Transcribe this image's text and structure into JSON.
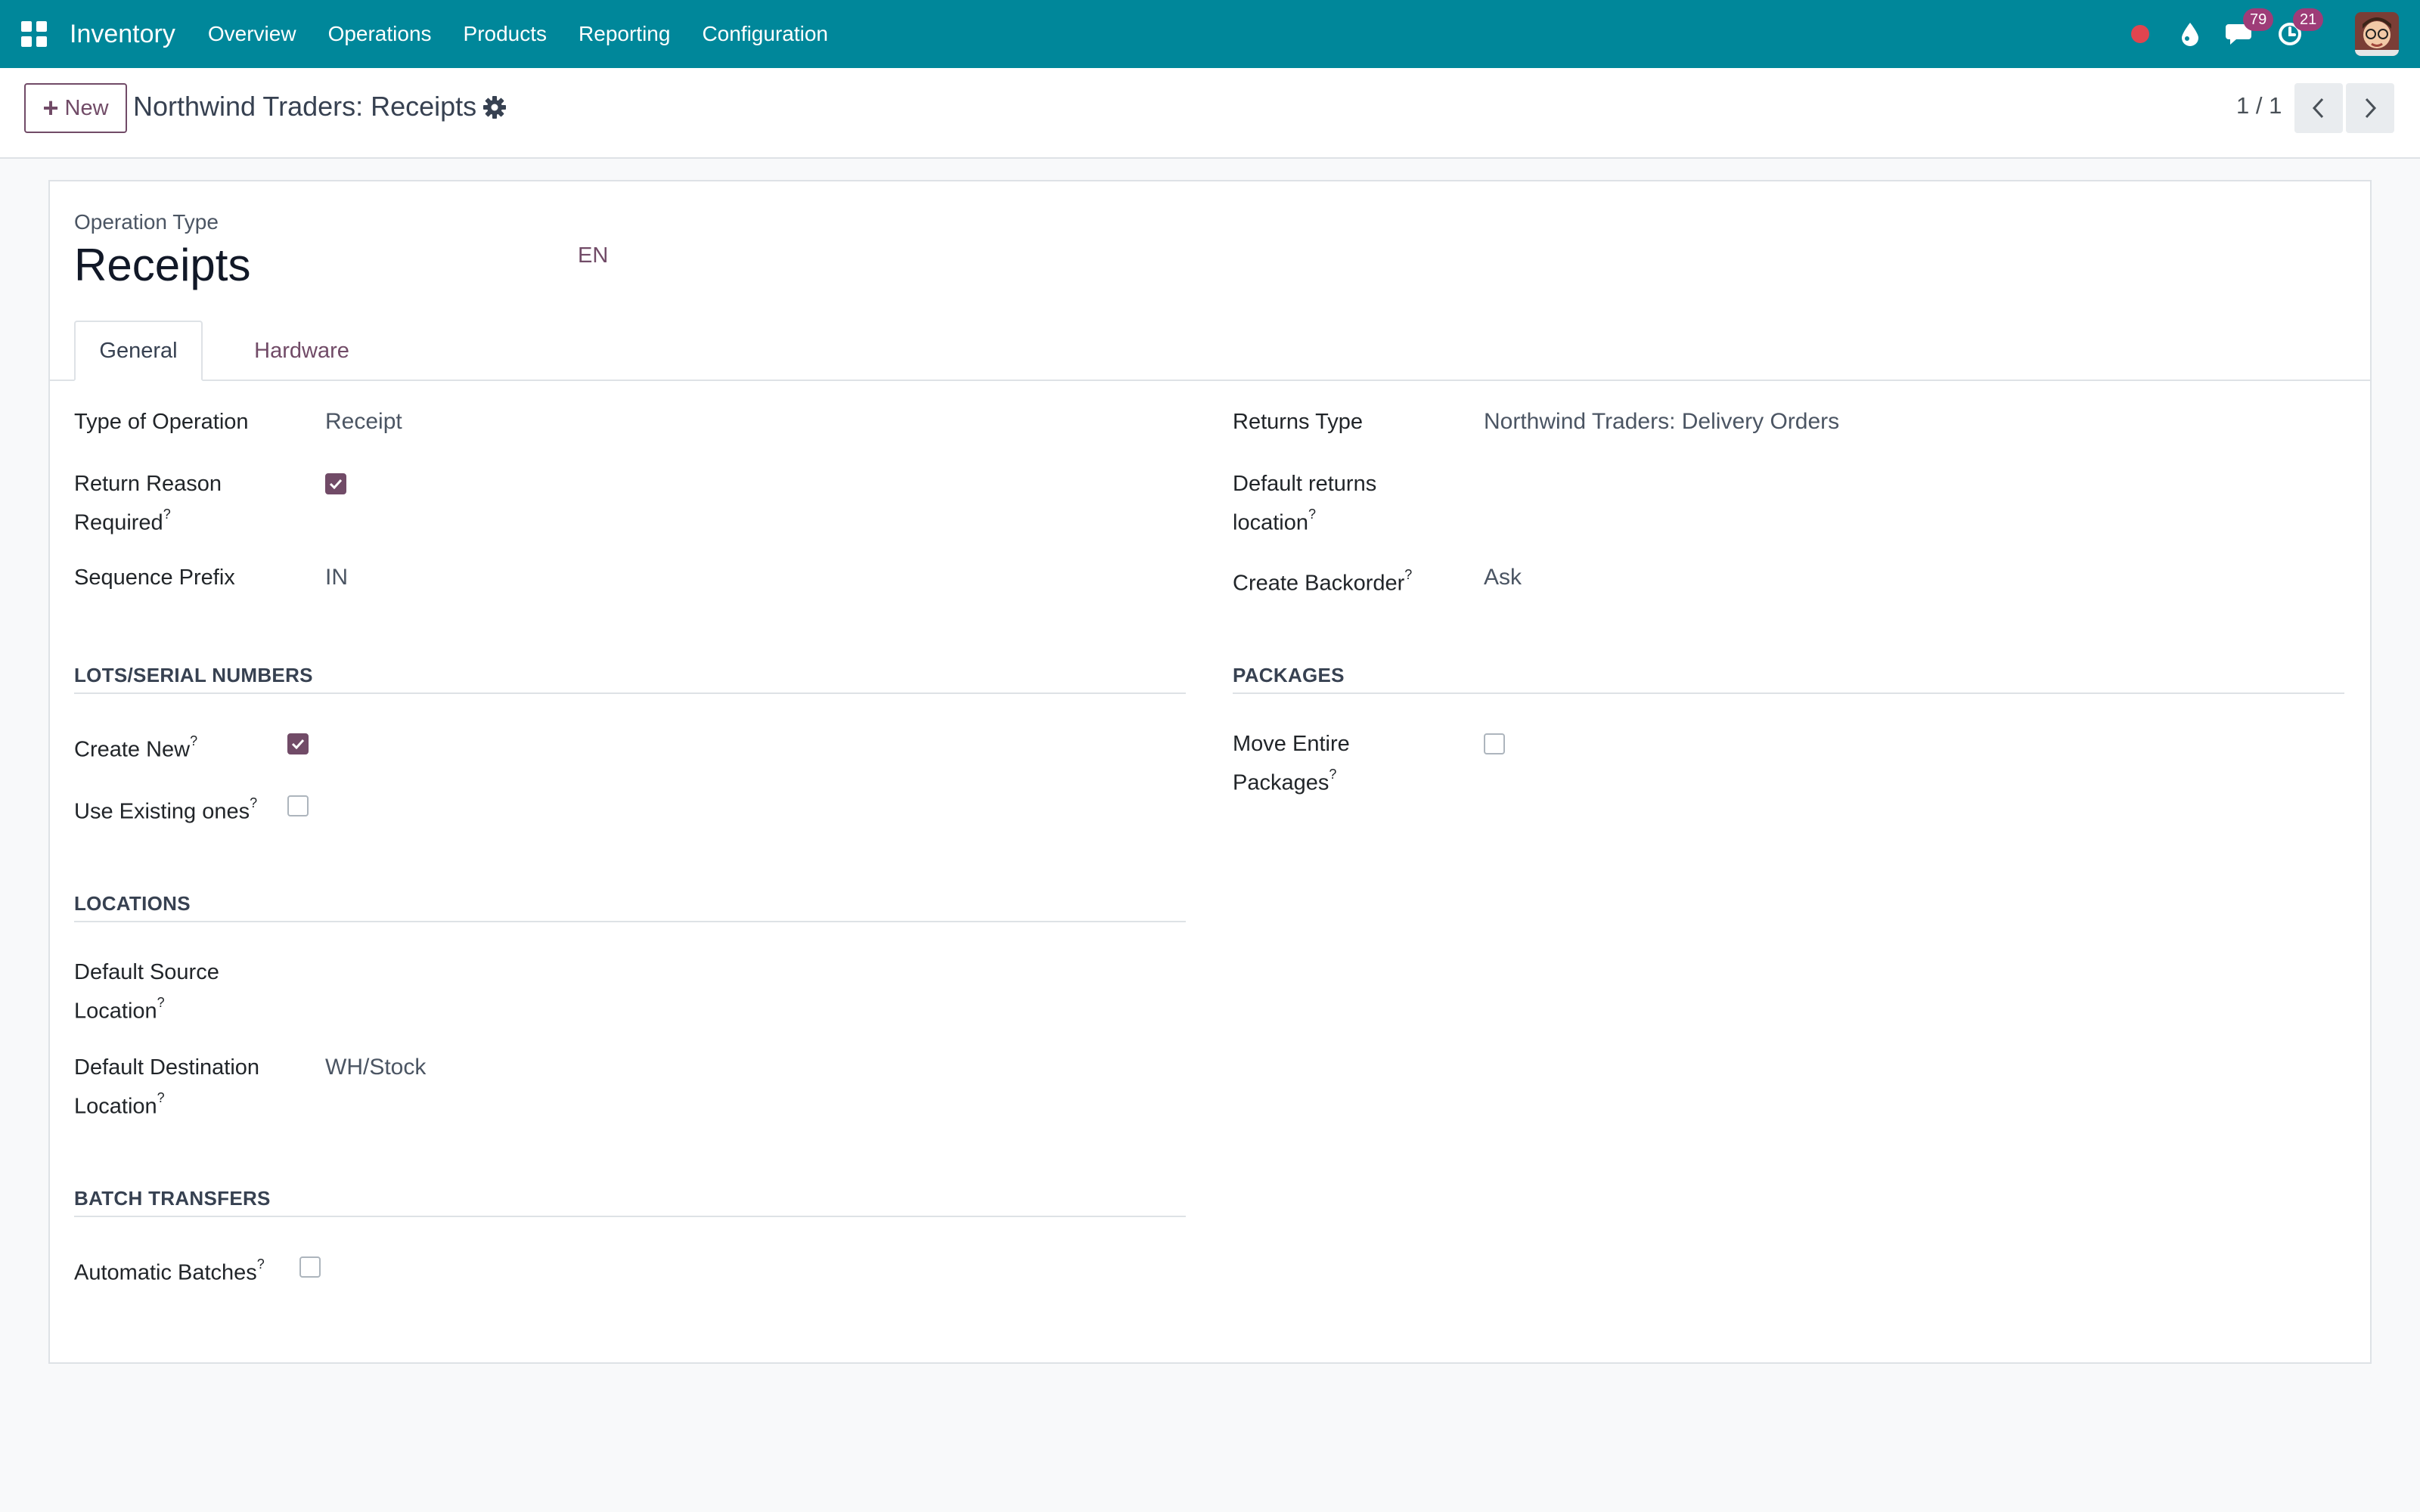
{
  "navbar": {
    "app_name": "Inventory",
    "menu": [
      "Overview",
      "Operations",
      "Products",
      "Reporting",
      "Configuration"
    ],
    "messages_count": "79",
    "activities_count": "21",
    "accent_color": "#00879a"
  },
  "control": {
    "new_label": "New",
    "breadcrumb": "Northwind Traders: Receipts",
    "pager": "1 / 1"
  },
  "form": {
    "record_label": "Operation Type",
    "record_name": "Receipts",
    "lang": "EN",
    "tabs": [
      "General",
      "Hardware"
    ],
    "left": {
      "type_of_operation": {
        "label": "Type of Operation",
        "value": "Receipt"
      },
      "return_reason": {
        "label_line1": "Return Reason",
        "label_line2": "Required",
        "checked": true
      },
      "sequence_prefix": {
        "label": "Sequence Prefix",
        "value": "IN"
      }
    },
    "right": {
      "returns_type": {
        "label": "Returns Type",
        "value": "Northwind Traders: Delivery Orders"
      },
      "default_returns_location": {
        "label_line1": "Default returns",
        "label_line2": "location",
        "value": ""
      },
      "create_backorder": {
        "label": "Create Backorder",
        "value": "Ask"
      }
    },
    "lots": {
      "title": "LOTS/SERIAL NUMBERS",
      "create_new": {
        "label": "Create New",
        "checked": true
      },
      "use_existing": {
        "label": "Use Existing ones",
        "checked": false
      }
    },
    "packages": {
      "title": "PACKAGES",
      "move_entire": {
        "label_line1": "Move Entire",
        "label_line2": "Packages",
        "checked": false
      }
    },
    "locations": {
      "title": "LOCATIONS",
      "default_source": {
        "label_line1": "Default Source",
        "label_line2": "Location",
        "value": ""
      },
      "default_destination": {
        "label_line1": "Default Destination",
        "label_line2": "Location",
        "value": "WH/Stock"
      }
    },
    "batch": {
      "title": "BATCH TRANSFERS",
      "automatic": {
        "label": "Automatic Batches",
        "checked": false
      }
    },
    "help_marker": "?"
  }
}
